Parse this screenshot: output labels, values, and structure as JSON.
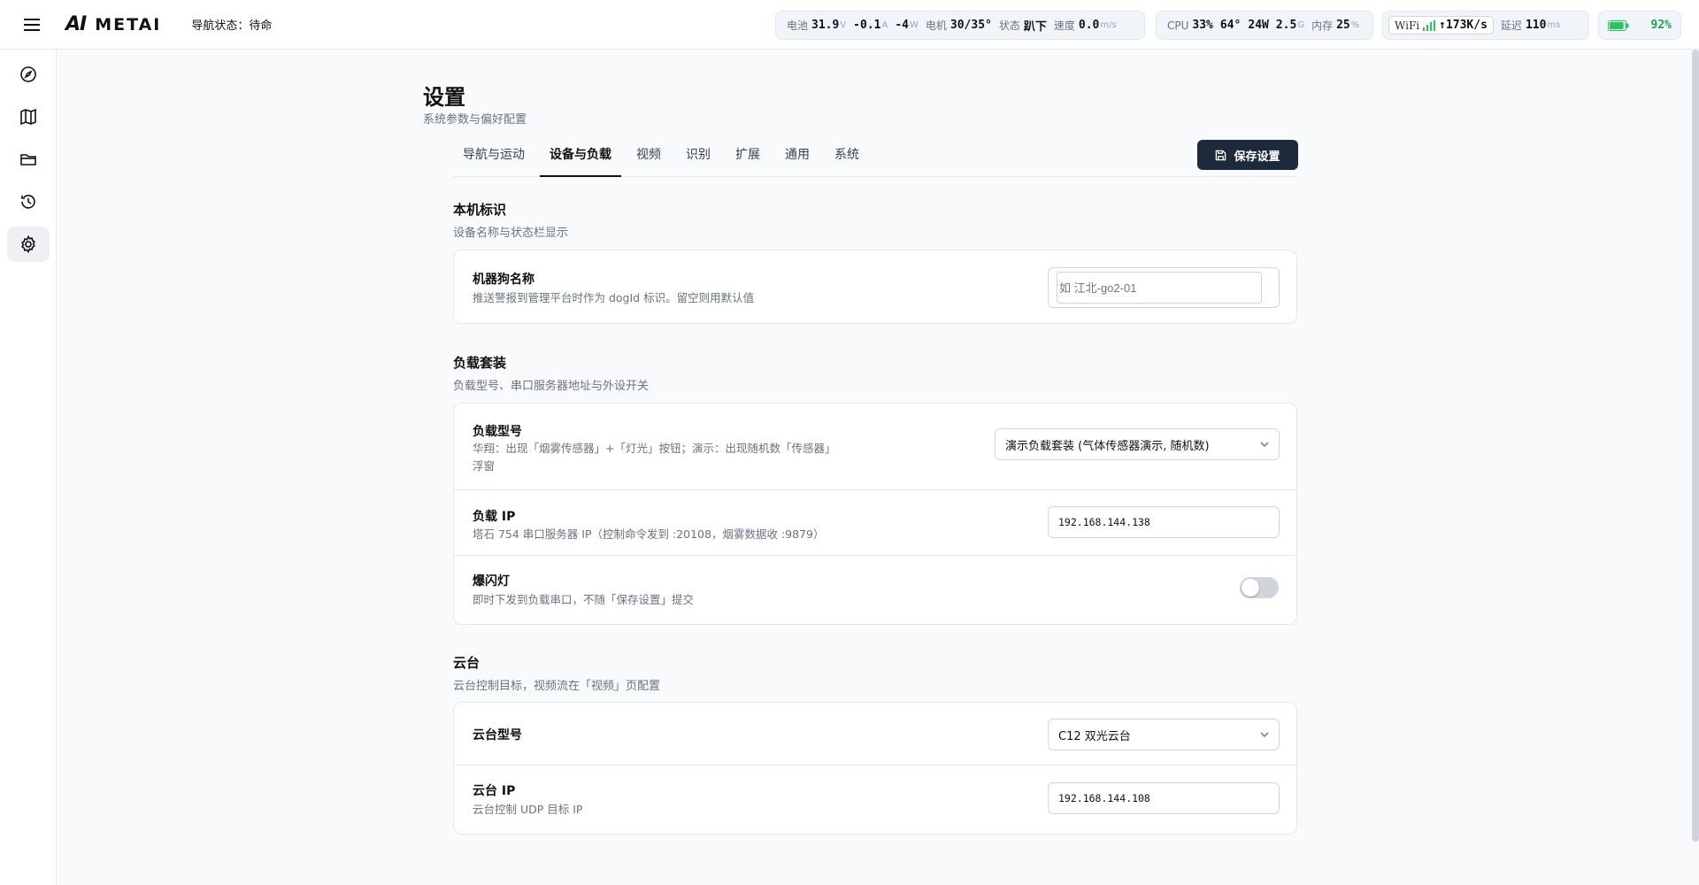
{
  "header": {
    "logo_mark": "AI",
    "logo_text": "METAI",
    "nav_status": "导航状态：待命",
    "stats": {
      "battery_label": "电池",
      "battery_voltage": "31.9",
      "battery_voltage_unit": "V",
      "current": "-0.1",
      "current_unit": "A",
      "power": "-4",
      "power_unit": "W",
      "motor_label": "电机",
      "motor_temp": "30/35°",
      "state_label": "状态",
      "state_value": "趴下",
      "speed_label": "速度",
      "speed_value": "0.0",
      "speed_unit": "m/s"
    },
    "system": {
      "cpu_label": "CPU",
      "cpu_value": "33%",
      "temp": "64°",
      "watt": "24W",
      "freq": "2.5",
      "freq_unit": "G",
      "mem_label": "内存",
      "mem_value": "25",
      "mem_unit": "%"
    },
    "network": {
      "wifi_label": "WiFi",
      "rate": "↑173K/s",
      "latency_label": "延迟",
      "latency_value": "110",
      "latency_unit": "ms"
    },
    "battery_percent": "92%",
    "battery_level": 0.92,
    "colors": {
      "wifi": "#22c55e",
      "battery": "#22c55e"
    }
  },
  "sidebar": {
    "items": [
      {
        "icon": "compass-icon"
      },
      {
        "icon": "map-icon"
      },
      {
        "icon": "folder-icon"
      },
      {
        "icon": "history-icon"
      },
      {
        "icon": "gear-icon",
        "active": true
      }
    ]
  },
  "page": {
    "title": "设置",
    "subtitle": "系统参数与偏好配置"
  },
  "tabs": [
    {
      "label": "导航与运动"
    },
    {
      "label": "设备与负载",
      "active": true
    },
    {
      "label": "视频"
    },
    {
      "label": "识别"
    },
    {
      "label": "扩展"
    },
    {
      "label": "通用"
    },
    {
      "label": "系统"
    }
  ],
  "save_button": "保存设置",
  "sections": {
    "identity": {
      "title": "本机标识",
      "subtitle": "设备名称与状态栏显示",
      "dog_name": {
        "label": "机器狗名称",
        "desc": "推送警报到管理平台时作为 dogId 标识。留空则用默认值",
        "placeholder": "如 江北-go2-01",
        "value": ""
      }
    },
    "payload": {
      "title": "负载套装",
      "subtitle": "负载型号、串口服务器地址与外设开关",
      "model": {
        "label": "负载型号",
        "desc_line1": "华翔：出现「烟雾传感器」+「灯光」按钮；演示：出现随机数「传感器」",
        "desc_line2": "浮窗",
        "value": "演示负载套装 (气体传感器演示, 随机数)"
      },
      "ip": {
        "label": "负载 IP",
        "desc": "塔石 754 串口服务器 IP（控制命令发到 :20108，烟雾数据收 :9879）",
        "value": "192.168.144.138"
      },
      "strobe": {
        "label": "爆闪灯",
        "desc": "即时下发到负载串口，不随「保存设置」提交",
        "on": false
      }
    },
    "gimbal": {
      "title": "云台",
      "subtitle": "云台控制目标，视频流在「视频」页配置",
      "model": {
        "label": "云台型号",
        "value": "C12 双光云台"
      },
      "ip": {
        "label": "云台 IP",
        "desc": "云台控制 UDP 目标 IP",
        "value": "192.168.144.108"
      }
    }
  }
}
